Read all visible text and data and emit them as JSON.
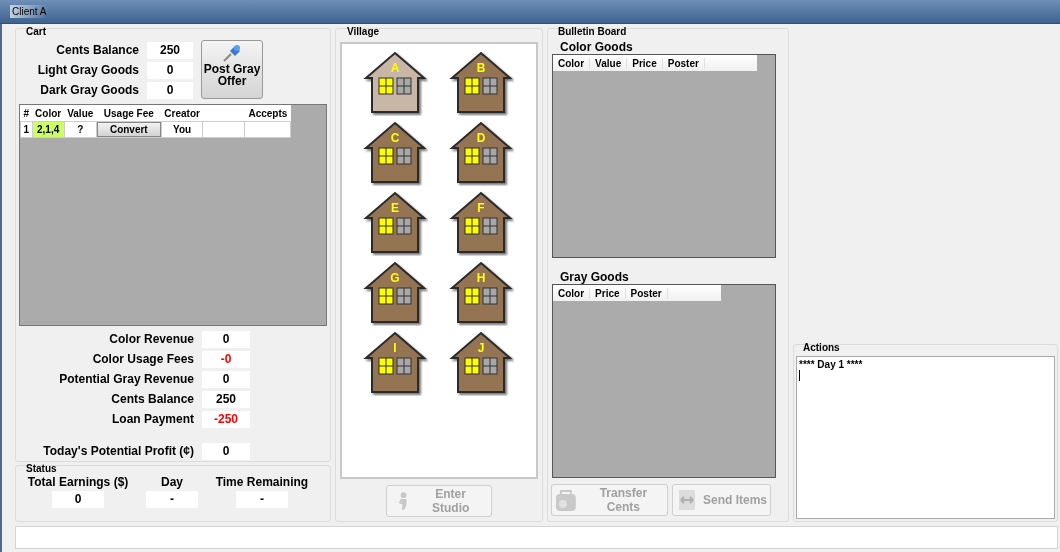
{
  "window": {
    "title": "Client A"
  },
  "cart": {
    "title": "Cart",
    "fields": [
      {
        "label": "Cents Balance",
        "value": "250"
      },
      {
        "label": "Light Gray Goods",
        "value": "0"
      },
      {
        "label": "Dark Gray Goods",
        "value": "0"
      }
    ],
    "post_button": "Post Gray Offer",
    "table": {
      "columns": [
        "#",
        "Color",
        "Value",
        "Usage Fee",
        "Creator",
        "",
        "Accepts"
      ],
      "rows": [
        {
          "number": "1",
          "color_value": "2,1,4",
          "color": "#ccff66",
          "value": "?",
          "usage_fee_button": "Convert",
          "creator": "You"
        }
      ]
    },
    "summary": [
      {
        "label": "Color Revenue",
        "value": "0",
        "color": "#000000"
      },
      {
        "label": "Color Usage Fees",
        "value": "-0",
        "color": "#ff0000"
      },
      {
        "label": "Potential Gray Revenue",
        "value": "0",
        "color": "#000000"
      },
      {
        "label": "Cents Balance",
        "value": "250",
        "color": "#000000"
      },
      {
        "label": "Loan Payment",
        "value": "-250",
        "color": "#ff0000"
      }
    ],
    "profit": {
      "label": "Today's Potential Profit (¢)",
      "value": "0"
    }
  },
  "status": {
    "title": "Status",
    "items": [
      {
        "label": "Total Earnings ($)",
        "value": "0"
      },
      {
        "label": "Day",
        "value": "-"
      },
      {
        "label": "Time Remaining",
        "value": "-"
      }
    ]
  },
  "village": {
    "title": "Village",
    "houses": [
      {
        "label": "A",
        "selected": true
      },
      {
        "label": "B",
        "selected": false
      },
      {
        "label": "C",
        "selected": false
      },
      {
        "label": "D",
        "selected": false
      },
      {
        "label": "E",
        "selected": false
      },
      {
        "label": "F",
        "selected": false
      },
      {
        "label": "G",
        "selected": false
      },
      {
        "label": "H",
        "selected": false
      },
      {
        "label": "I",
        "selected": false
      },
      {
        "label": "J",
        "selected": false
      }
    ],
    "enter_button": {
      "label": "Enter Studio",
      "disabled": true
    }
  },
  "bulletin": {
    "title": "Bulletin Board",
    "color_goods": {
      "title": "Color Goods",
      "columns": [
        "Color",
        "Value",
        "Price",
        "Poster"
      ]
    },
    "gray_goods": {
      "title": "Gray Goods",
      "columns": [
        "Color",
        "Price",
        "Poster"
      ]
    },
    "buttons": [
      {
        "label": "Transfer Cents",
        "kind": "transfer",
        "disabled": true
      },
      {
        "label": "Send Items",
        "kind": "send",
        "disabled": true
      }
    ]
  },
  "actions": {
    "title": "Actions",
    "lines": [
      "**** Day 1 ****"
    ]
  }
}
